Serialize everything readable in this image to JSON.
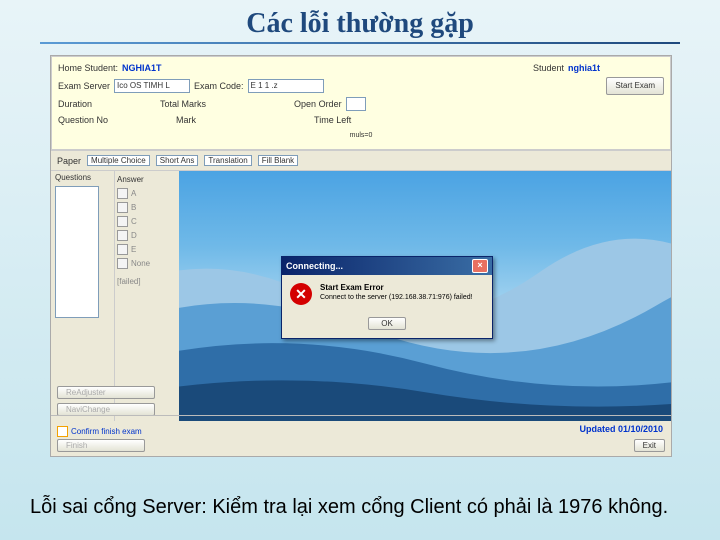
{
  "slide": {
    "title": "Các lỗi thường gặp",
    "caption": "Lỗi  sai cổng Server: Kiểm tra lại xem cổng Client có phải là 1976 không."
  },
  "header": {
    "home_lbl": "Home Student:",
    "home_val": "NGHIA1T",
    "student_lbl": "Student",
    "student_val": "nghia1t",
    "server_lbl": "Exam Server",
    "server_val": "Ico  OS TIMH L",
    "code_lbl": "Exam Code:",
    "code_val": "E  1   1   .z",
    "startexam_btn": "Start Exam",
    "duration_lbl": "Duration",
    "marks_lbl": "Total Marks",
    "order_lbl": "Open Order",
    "question_lbl": "Question No",
    "mark_lbl": "Mark",
    "timeleft_lbl": "Time Left",
    "marksval": "muls=0"
  },
  "paper": {
    "lbl": "Paper",
    "opt1": "Multiple Choice",
    "opt2": "Short Ans",
    "opt3": "Translation",
    "opt4": "Fill Blank"
  },
  "qpanel": {
    "hdr": "Questions",
    "ans_hdr": "Answer",
    "opts": [
      "A",
      "B",
      "C",
      "D",
      "E",
      "None"
    ],
    "fail": "[failed]"
  },
  "buttons": {
    "reg": "ReAdjuster",
    "nav": "NaviChange",
    "confirm": "Confirm finish exam",
    "finish": "Finish",
    "exit": "Exit"
  },
  "footer": {
    "updated": "Updated 01/10/2010"
  },
  "dialog": {
    "title": "Connecting...",
    "err_head": "Start Exam Error",
    "err_body": "Connect to the server (192.168.38.71:976) failed!",
    "ok": "OK"
  }
}
